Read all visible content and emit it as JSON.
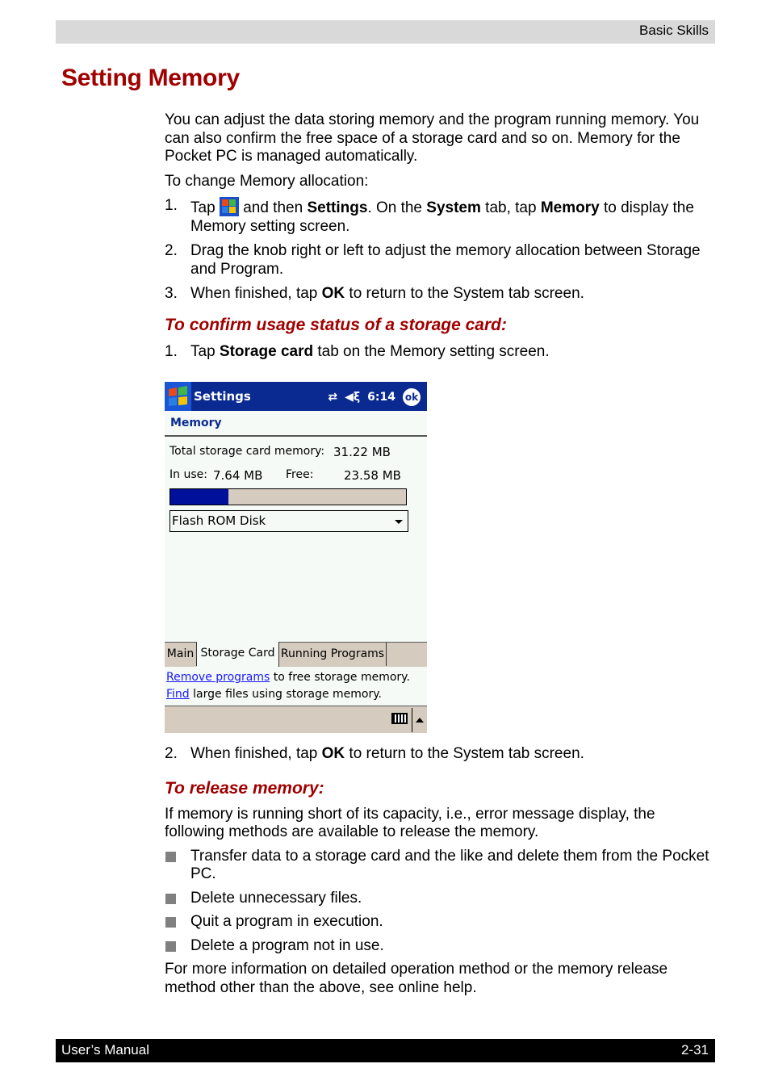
{
  "header": {
    "section": "Basic Skills"
  },
  "title": "Setting Memory",
  "intro": "You can adjust the data storing memory and the program running memory. You can also confirm the free space of a storage card and so on. Memory for the Pocket PC is managed automatically.",
  "change_alloc": {
    "lead": "To change Memory allocation:",
    "steps": [
      {
        "num": "1.",
        "parts": [
          "Tap ",
          "[start-icon]",
          " and then ",
          "Settings",
          ". On the ",
          "System",
          " tab, tap ",
          "Memory",
          " to display the Memory setting screen."
        ]
      },
      {
        "num": "2.",
        "text": "Drag the knob right or left to adjust the memory allocation between Storage and Program."
      },
      {
        "num": "3.",
        "pre": "When finished, tap ",
        "bold": "OK",
        "post": " to return to the System tab screen."
      }
    ]
  },
  "confirm_section": {
    "heading": "To confirm usage status of a storage card:",
    "step1": {
      "num": "1.",
      "pre": "Tap ",
      "bold": "Storage card",
      "post": " tab on the Memory setting screen."
    },
    "step2": {
      "num": "2.",
      "pre": "When finished, tap ",
      "bold": "OK",
      "post": " to return to the System tab screen."
    }
  },
  "device_screen": {
    "app_title": "Settings",
    "time": "6:14",
    "ok_label": "ok",
    "status_icons": [
      "sync-icon",
      "volume-icon"
    ],
    "heading": "Memory",
    "total_label": "Total storage card memory:",
    "total_value": "31.22 MB",
    "in_use_label": "In use:",
    "in_use_value": "7.64 MB",
    "free_label": "Free:",
    "free_value": "23.58 MB",
    "usage_fraction": 0.245,
    "colors": {
      "titlebar": "#0a2a91",
      "bar_fill": "#00109a",
      "bar_bg": "#d6cbbf",
      "link": "#1a1aff"
    },
    "storage_select": "Flash ROM Disk",
    "tabs": [
      {
        "label": "Main",
        "active": false
      },
      {
        "label": "Storage Card",
        "active": true
      },
      {
        "label": "Running Programs",
        "active": false
      }
    ],
    "link1": {
      "link": "Remove programs",
      "rest": " to free storage memory."
    },
    "link2": {
      "link": "Find",
      "rest": " large files using storage memory."
    }
  },
  "release_section": {
    "heading": "To release memory:",
    "intro": "If memory is running short of its capacity, i.e., error message display, the following methods are available to release the memory.",
    "bullets": [
      "Transfer data to a storage card and the like and delete them from the Pocket PC.",
      "Delete unnecessary files.",
      "Quit a program in execution.",
      "Delete a program not in use."
    ],
    "closing": "For more information on detailed operation method or the memory release method other than the above, see online help."
  },
  "footer": {
    "left": "User’s Manual",
    "right": "2-31"
  }
}
